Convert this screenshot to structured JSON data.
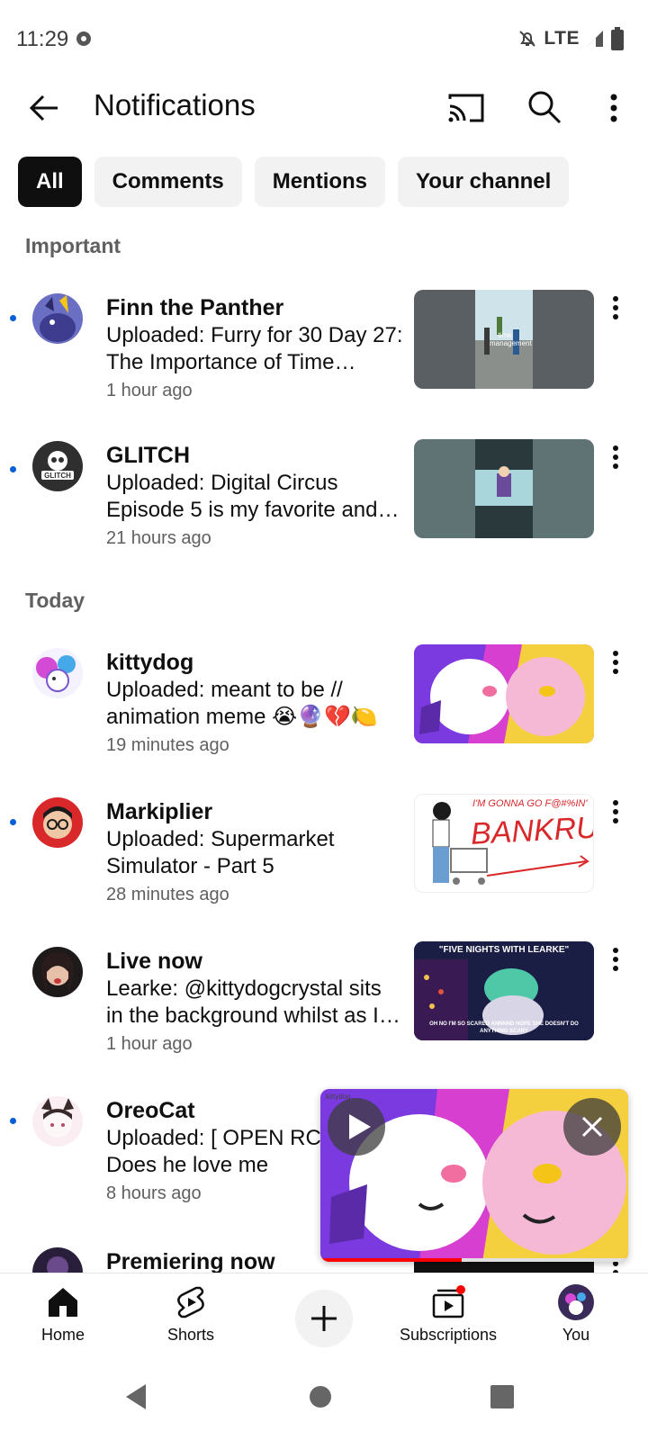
{
  "status_bar": {
    "time": "11:29",
    "network": "LTE"
  },
  "app_bar": {
    "title": "Notifications"
  },
  "chips": [
    {
      "label": "All",
      "active": true
    },
    {
      "label": "Comments",
      "active": false
    },
    {
      "label": "Mentions",
      "active": false
    },
    {
      "label": "Your channel",
      "active": false
    }
  ],
  "sections": {
    "important": "Important",
    "today": "Today"
  },
  "notifications": [
    {
      "channel": "Finn the Panther",
      "body": "Uploaded: Furry for 30 Day 27: The Importance of Time Management",
      "time": "1 hour ago",
      "unread": true
    },
    {
      "channel": "GLITCH",
      "body": "Uploaded: Digital Circus Episode 5 is my favorite and here's why",
      "time": "21 hours ago",
      "unread": true
    },
    {
      "channel": "kittydog",
      "body": "Uploaded: meant to be // animation meme 😭🔮💔🍋",
      "time": "19 minutes ago",
      "unread": false
    },
    {
      "channel": "Markiplier",
      "body": "Uploaded: Supermarket Simulator - Part 5",
      "time": "28 minutes ago",
      "unread": true
    },
    {
      "channel": "Live now",
      "body": "Learke: @kittydogcrystal sits in the background whilst as I play",
      "time": "1 hour ago",
      "unread": false
    },
    {
      "channel": "OreoCat",
      "body": "Uploaded: [ OPEN RC YCH ] Does he love me",
      "time": "8 hours ago",
      "unread": true
    },
    {
      "channel": "Premiering now",
      "body": "",
      "time": "",
      "unread": false
    }
  ],
  "thumbnails": {
    "finn_caption": "time management",
    "markiplier_top": "I'M GONNA GO F@#%IN'",
    "markiplier_big": "BANKRUPT",
    "learke_top": "\"FIVE NIGHTS WITH LEARKE\"",
    "learke_bottom": "OH NO I'M SO SCARED ANNNND HOPE SHE DOESN'T DO ANYTHING SCARY"
  },
  "mini_player": {
    "watermark": "kittydog",
    "progress": 0.46
  },
  "bottom_nav": {
    "home": "Home",
    "shorts": "Shorts",
    "subscriptions": "Subscriptions",
    "you": "You"
  },
  "colors": {
    "accent": "#065fd4",
    "brand_red": "#ff0000",
    "chip_active": "#0f0f0f"
  }
}
